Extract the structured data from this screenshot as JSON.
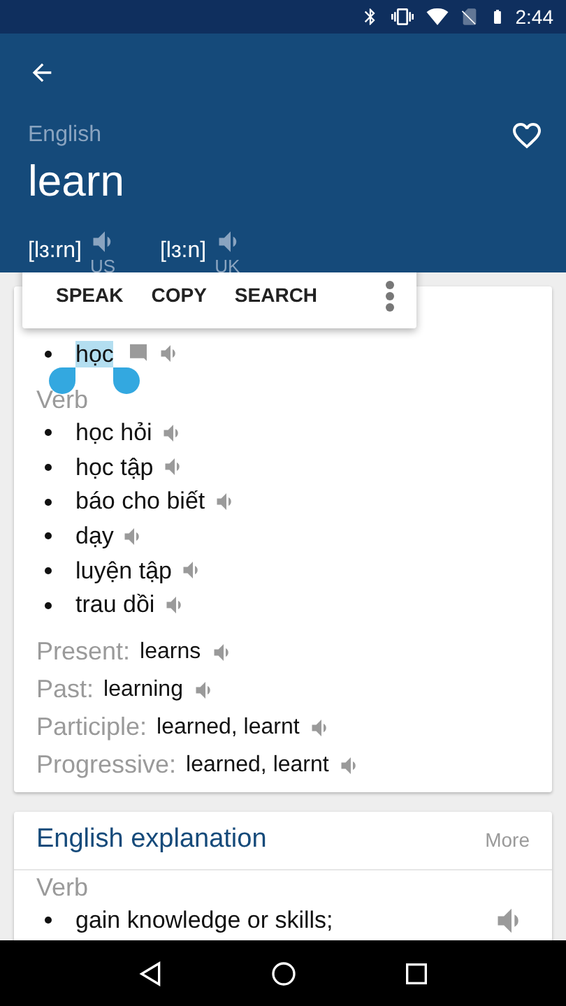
{
  "status_bar": {
    "time": "2:44"
  },
  "header": {
    "language": "English",
    "word": "learn",
    "favorite": false,
    "pronunciations": [
      {
        "ipa": "[lɜ:rn]",
        "region": "US"
      },
      {
        "ipa": "[lɜ:n]",
        "region": "UK"
      }
    ]
  },
  "selection_menu": {
    "actions": [
      "SPEAK",
      "COPY",
      "SEARCH"
    ]
  },
  "definition": {
    "groups": [
      {
        "items": [
          {
            "text": "học",
            "selected": true,
            "note": true
          }
        ]
      },
      {
        "pos": "Verb",
        "items": [
          {
            "text": "học hỏi",
            "selected": false,
            "note": false
          },
          {
            "text": "học tập",
            "selected": false,
            "note": false
          },
          {
            "text": "báo cho biết",
            "selected": false,
            "note": false
          },
          {
            "text": "dạy",
            "selected": false,
            "note": false
          },
          {
            "text": "luyện tập",
            "selected": false,
            "note": false
          },
          {
            "text": "trau dồi",
            "selected": false,
            "note": false
          }
        ]
      }
    ],
    "forms": [
      {
        "label": "Present:",
        "value": "learns"
      },
      {
        "label": "Past:",
        "value": "learning"
      },
      {
        "label": "Participle:",
        "value": "learned, learnt"
      },
      {
        "label": "Progressive:",
        "value": "learned, learnt"
      }
    ]
  },
  "explanation": {
    "title": "English explanation",
    "more": "More",
    "pos": "Verb",
    "items": [
      "gain knowledge or skills;"
    ]
  }
}
